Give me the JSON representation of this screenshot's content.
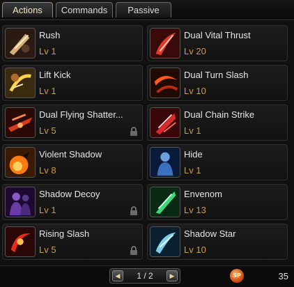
{
  "tabs": [
    {
      "label": "Actions",
      "active": true
    },
    {
      "label": "Commands",
      "active": false
    },
    {
      "label": "Passive",
      "active": false
    }
  ],
  "skills": [
    {
      "name": "Rush",
      "level": "Lv 1",
      "icon": "rush-icon",
      "locked": false
    },
    {
      "name": "Dual Vital Thrust",
      "level": "Lv 20",
      "icon": "dual-vital-thrust-icon",
      "locked": false
    },
    {
      "name": "Lift Kick",
      "level": "Lv 1",
      "icon": "lift-kick-icon",
      "locked": false
    },
    {
      "name": "Dual Turn Slash",
      "level": "Lv 10",
      "icon": "dual-turn-slash-icon",
      "locked": false
    },
    {
      "name": "Dual Flying Shatter...",
      "level": "Lv 5",
      "icon": "dual-flying-shatter-icon",
      "locked": true
    },
    {
      "name": "Dual Chain Strike",
      "level": "Lv 1",
      "icon": "dual-chain-strike-icon",
      "locked": false
    },
    {
      "name": "Violent Shadow",
      "level": "Lv 8",
      "icon": "violent-shadow-icon",
      "locked": false
    },
    {
      "name": "Hide",
      "level": "Lv 1",
      "icon": "hide-icon",
      "locked": false
    },
    {
      "name": "Shadow Decoy",
      "level": "Lv 1",
      "icon": "shadow-decoy-icon",
      "locked": true
    },
    {
      "name": "Envenom",
      "level": "Lv 13",
      "icon": "envenom-icon",
      "locked": false
    },
    {
      "name": "Rising Slash",
      "level": "Lv 5",
      "icon": "rising-slash-icon",
      "locked": true
    },
    {
      "name": "Shadow Star",
      "level": "Lv 10",
      "icon": "shadow-star-icon",
      "locked": false
    }
  ],
  "pager": {
    "text": "1 / 2",
    "prev_icon": "prev-arrow-icon",
    "next_icon": "next-arrow-icon"
  },
  "skill_points": {
    "badge": "SP",
    "value": "35",
    "icon": "skill-points-icon"
  },
  "colors": {
    "level_text": "#cf9a49",
    "name_text": "#e6e6e6",
    "active_tab_border": "#9a8a5a"
  }
}
